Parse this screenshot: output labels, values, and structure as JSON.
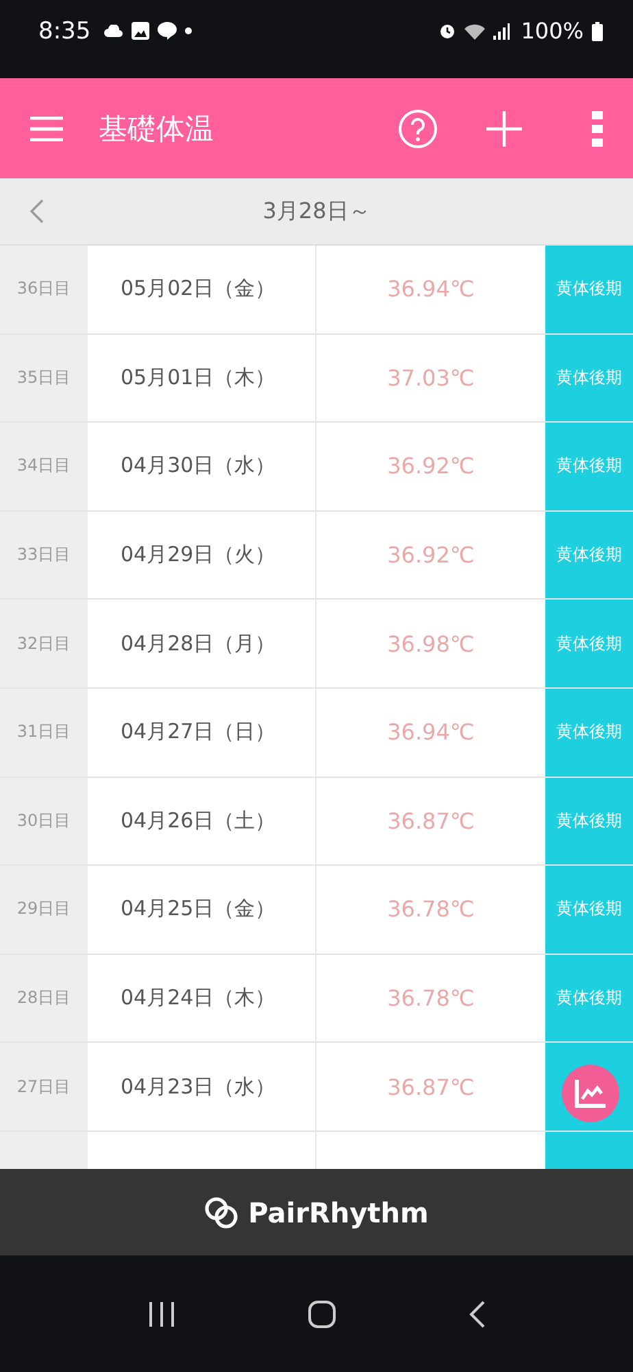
{
  "status_bar": {
    "time": "8:35",
    "battery": "100%"
  },
  "app_bar": {
    "title": "基礎体温"
  },
  "period_nav": {
    "label": "3月28日～"
  },
  "rows": [
    {
      "day": "36日目",
      "date": "05月02日（金）",
      "temp": "36.94℃",
      "phase": "黄体後期"
    },
    {
      "day": "35日目",
      "date": "05月01日（木）",
      "temp": "37.03℃",
      "phase": "黄体後期"
    },
    {
      "day": "34日目",
      "date": "04月30日（水）",
      "temp": "36.92℃",
      "phase": "黄体後期"
    },
    {
      "day": "33日目",
      "date": "04月29日（火）",
      "temp": "36.92℃",
      "phase": "黄体後期"
    },
    {
      "day": "32日目",
      "date": "04月28日（月）",
      "temp": "36.98℃",
      "phase": "黄体後期"
    },
    {
      "day": "31日目",
      "date": "04月27日（日）",
      "temp": "36.94℃",
      "phase": "黄体後期"
    },
    {
      "day": "30日目",
      "date": "04月26日（土）",
      "temp": "36.87℃",
      "phase": "黄体後期"
    },
    {
      "day": "29日目",
      "date": "04月25日（金）",
      "temp": "36.78℃",
      "phase": "黄体後期"
    },
    {
      "day": "28日目",
      "date": "04月24日（木）",
      "temp": "36.78℃",
      "phase": "黄体後期"
    },
    {
      "day": "27日目",
      "date": "04月23日（水）",
      "temp": "36.87℃"
    }
  ],
  "footer": {
    "brand": "PairRhythm"
  }
}
